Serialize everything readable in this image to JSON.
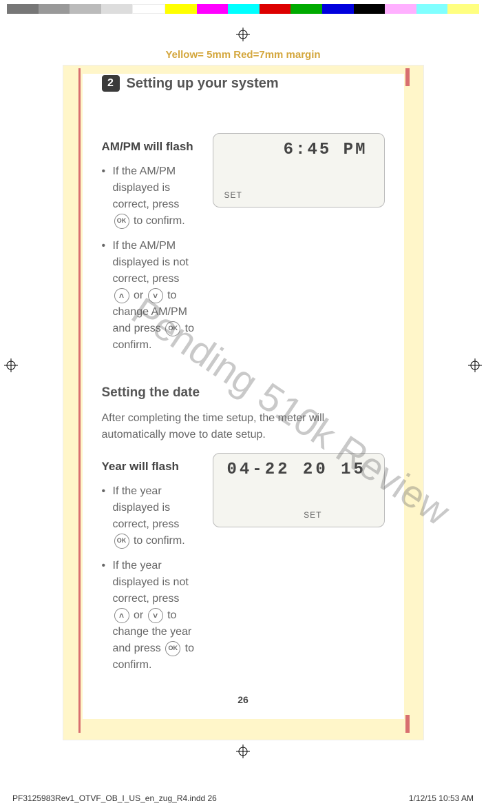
{
  "colorBar": [
    "#777",
    "#999",
    "#bbb",
    "#ddd",
    "#fff",
    "#ffff00",
    "#ff00ff",
    "#00ffff",
    "#dd0000",
    "#00aa00",
    "#0000dd",
    "#000000",
    "#ffb0ff",
    "#80ffff",
    "#ffff80"
  ],
  "marginLabel": "Yellow= 5mm  Red=7mm margin",
  "chapter": {
    "num": "2",
    "title": "Setting up your system"
  },
  "watermark": "Pending 510k Review",
  "section1": {
    "head": "AM/PM will flash",
    "b1a": "If the AM/PM displayed is correct, press ",
    "b1b": " to confirm.",
    "b2a": "If the AM/PM displayed is not correct, press ",
    "b2b": " or ",
    "b2c": " to change AM/PM and press ",
    "b2d": " to confirm.",
    "lcd": {
      "time": "6:45 PM",
      "mode": "SET"
    }
  },
  "section2": {
    "head": "Setting the date",
    "intro": "After completing the time setup, the meter will automatically move to date setup."
  },
  "section3": {
    "head": "Year will flash",
    "b1a": "If the year displayed is correct, press ",
    "b1b": " to confirm.",
    "b2a": "If the year displayed is not correct, press ",
    "b2b": " or ",
    "b2c": " to change the year and press ",
    "b2d": " to confirm.",
    "lcd": {
      "date": "04-22  20 15",
      "mode": "SET"
    }
  },
  "icons": {
    "ok": "OK",
    "up": "˄",
    "down": "˅"
  },
  "pageNum": "26",
  "footer": {
    "left": "PF3125983Rev1_OTVF_OB_I_US_en_zug_R4.indd   26",
    "right": "1/12/15   10:53 AM"
  }
}
